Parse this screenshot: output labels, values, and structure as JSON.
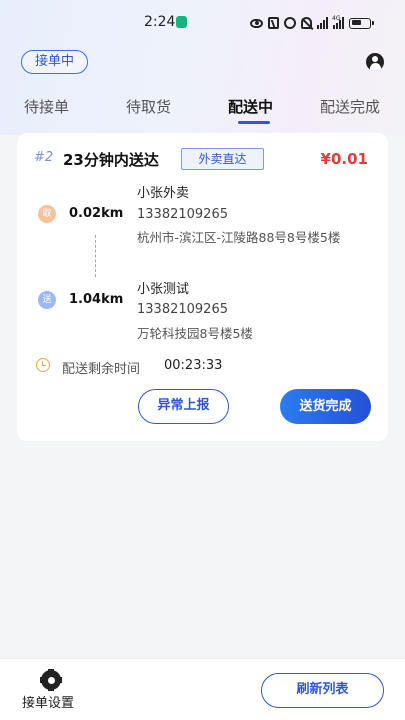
{
  "status_bar": {
    "time": "2:24",
    "network": "4G"
  },
  "header": {
    "status_badge": "接单中"
  },
  "tabs": [
    {
      "label": "待接单"
    },
    {
      "label": "待取货"
    },
    {
      "label": "配送中"
    },
    {
      "label": "配送完成"
    }
  ],
  "active_tab": "配送中",
  "order": {
    "number": "#2",
    "deliver_time": "23分钟内送达",
    "type_tag": "外卖直达",
    "fee": "¥0.01",
    "pickup": {
      "badge": "取",
      "distance": "0.02km",
      "name": "小张外卖",
      "phone": "13382109265",
      "address": "杭州市-滨江区-江陵路88号8号楼5楼"
    },
    "dropoff": {
      "badge": "送",
      "distance": "1.04km",
      "name": "小张测试",
      "phone": "13382109265",
      "address": "万轮科技园8号楼5楼"
    },
    "remaining_label": "配送剩余时间",
    "remaining_time": "00:23:33",
    "exception_button": "异常上报",
    "delivered_button": "送货完成"
  },
  "bottom_bar": {
    "settings_label": "接单设置",
    "refresh_button": "刷新列表"
  }
}
